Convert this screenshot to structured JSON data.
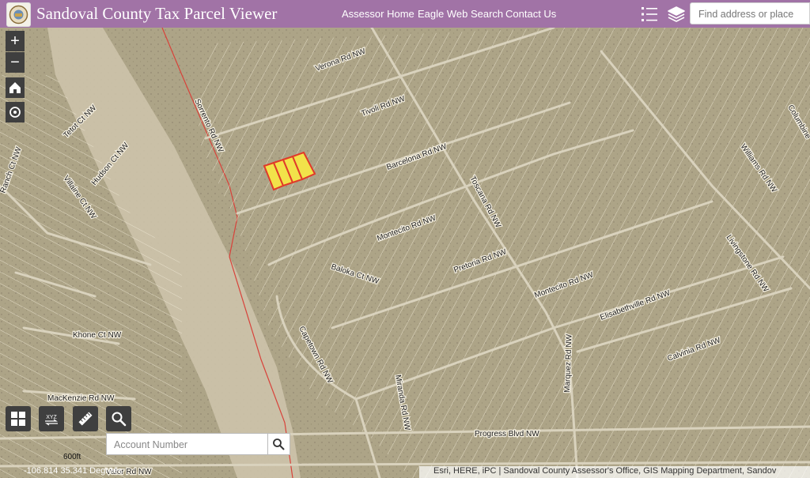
{
  "header": {
    "title": "Sandoval County Tax Parcel Viewer",
    "links": [
      "Assessor Home",
      "Eagle Web Search",
      "Contact Us"
    ],
    "search_placeholder": "Find address or place",
    "bg_color": "#a173a6"
  },
  "map_controls": {
    "zoom_in": "+",
    "zoom_out": "−",
    "icons": [
      "home-icon",
      "locate-icon",
      "basemap-gallery-icon",
      "coordinate-conversion-icon",
      "measure-icon",
      "search-icon",
      "layer-list-icon",
      "layers-icon"
    ]
  },
  "account_search": {
    "placeholder": "Account Number"
  },
  "scale": {
    "label": "600ft"
  },
  "status": {
    "coordinates": "-106.814 35.341 Degrees",
    "attribution": "Esri, HERE, iPC | Sandoval County Assessor's Office, GIS Mapping Department, Sandov"
  },
  "roads": [
    "Verona Rd NW",
    "Tivoli Rd NW",
    "Barcelona Rd NW",
    "Sorrento Rd NW",
    "Toscana Rd NW",
    "Montecito Rd NW",
    "Pretoria Rd NW",
    "Baloka Ct NW",
    "Capetown Rd NW",
    "Elisabethville Rd NW",
    "Livingstone Rd NW",
    "Calvinia Rd NW",
    "Williams Rd NW",
    "Khone Ct NW",
    "MacKenzie Rd NW",
    "Progress Blvd NW",
    "Valor Rd NW",
    "Villaine Ct NW",
    "Hudson Ct NW",
    "Tetot Ct NW",
    "Miranda Rd NW",
    "Montecito Rd NW",
    "Marquez Rd NW",
    "Ranch Ct NW",
    "Columbine"
  ],
  "highlight_color": "#f2e24a",
  "parcel_outline_color": "#e03a2a"
}
